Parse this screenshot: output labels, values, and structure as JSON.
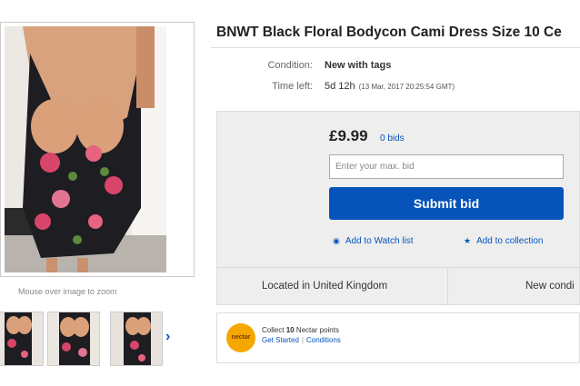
{
  "gallery": {
    "zoom_hint": "Mouse over image to zoom",
    "next_arrow": "›"
  },
  "listing": {
    "title": "BNWT Black Floral Bodycon Cami Dress Size 10 Ce",
    "condition_label": "Condition:",
    "condition_value": "New with tags",
    "time_left_label": "Time left:",
    "time_left_value": "5d 12h",
    "time_left_end": "(13 Mar, 2017   20:25:54 GMT)"
  },
  "bidding": {
    "price": "£9.99",
    "bids": "0 bids",
    "max_bid_placeholder": "Enter your max. bid",
    "submit_label": "Submit bid",
    "watch_label": "Add to Watch list",
    "collection_label": "Add to collection"
  },
  "location": {
    "located": "Located in United Kingdom",
    "condition_short": "New condi"
  },
  "nectar": {
    "logo_text": "nectar",
    "collect_prefix": "Collect",
    "points": "10",
    "collect_suffix": "Nectar points",
    "get_started": "Get Started",
    "conditions": "Conditions"
  },
  "colors": {
    "link_blue": "#0654ba",
    "panel_grey": "#eeeeef",
    "nectar_orange": "#f5a700"
  }
}
